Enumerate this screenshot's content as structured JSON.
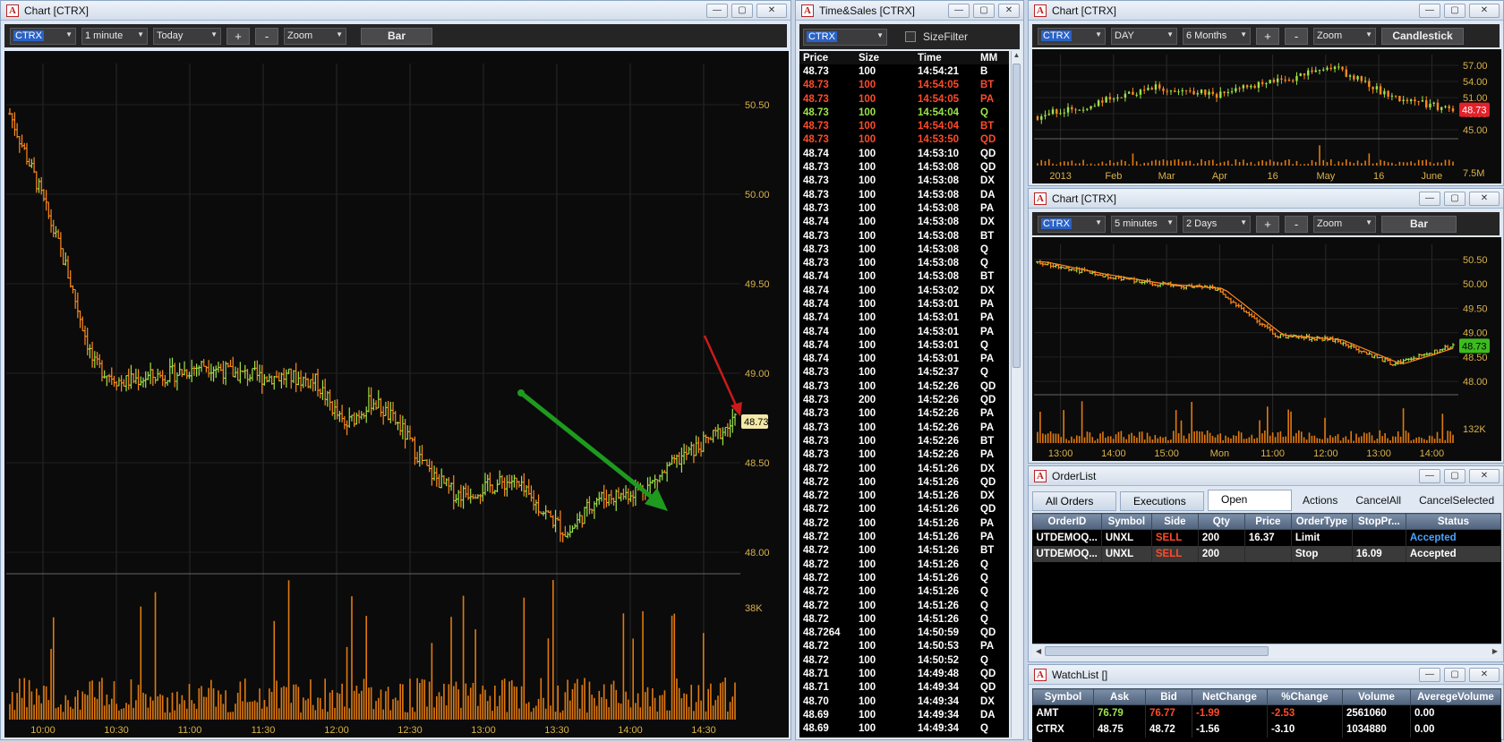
{
  "chart1": {
    "title": "Chart [CTRX]",
    "symbol": "CTRX",
    "interval": "1 minute",
    "range": "Today",
    "zoom": "Zoom",
    "plus": "+",
    "minus": "-",
    "style": "Bar",
    "price_ticks": [
      "50.50",
      "50.00",
      "49.50",
      "49.00",
      "48.50",
      "48.00"
    ],
    "price_tag": "48.73",
    "volume_tick": "38K",
    "time_ticks": [
      "10:00",
      "10:30",
      "11:00",
      "11:30",
      "12:00",
      "12:30",
      "13:00",
      "13:30",
      "14:00",
      "14:30"
    ]
  },
  "chart_data": [
    {
      "type": "line",
      "title": "",
      "xlabel": "",
      "ylabel": "",
      "ylim": [
        47.9,
        50.7
      ],
      "x": [
        "09:45",
        "09:50",
        "09:55",
        "10:00",
        "10:10",
        "10:20",
        "10:30",
        "10:45",
        "11:00",
        "11:10",
        "11:30",
        "11:45",
        "12:00",
        "12:10",
        "12:20",
        "12:30",
        "12:45",
        "13:00",
        "13:15",
        "13:30",
        "13:35",
        "13:45",
        "14:00",
        "14:15",
        "14:30",
        "14:40",
        "14:45"
      ],
      "series": [
        {
          "values": [
            50.45,
            50.05,
            49.6,
            49.05,
            48.95,
            48.98,
            49.0,
            49.05,
            49.0,
            48.98,
            48.98,
            48.95,
            48.7,
            48.85,
            48.7,
            48.45,
            48.32,
            48.36,
            48.4,
            48.25,
            48.1,
            48.3,
            48.32,
            48.38,
            48.52,
            48.62,
            48.73
          ]
        }
      ],
      "volume_ticks": [
        "38K"
      ]
    },
    {
      "type": "line",
      "title": "",
      "ylim": [
        44.0,
        58.0
      ],
      "x": [
        "2013",
        "Feb",
        "Mar",
        "Apr",
        "16",
        "May",
        "16",
        "June"
      ],
      "series": [
        {
          "values": [
            47.5,
            50.0,
            53.0,
            51.5,
            54.0,
            56.5,
            51.0,
            48.73
          ]
        }
      ],
      "price_ticks": [
        "57.00",
        "54.00",
        "51.00",
        "48.00",
        "45.00"
      ],
      "price_tag": "48.73"
    },
    {
      "type": "line",
      "title": "",
      "ylim": [
        47.8,
        50.7
      ],
      "x": [
        "13:00",
        "14:00",
        "15:00",
        "Mon",
        "11:00",
        "12:00",
        "13:00",
        "14:00"
      ],
      "series": [
        {
          "values": [
            50.45,
            50.2,
            50.0,
            49.9,
            48.95,
            48.85,
            48.35,
            48.73
          ]
        }
      ],
      "price_ticks": [
        "50.50",
        "50.00",
        "49.50",
        "49.00",
        "48.50",
        "48.00"
      ],
      "price_tag": "48.73"
    }
  ],
  "timesales": {
    "title": "Time&Sales [CTRX]",
    "symbol": "CTRX",
    "size_filter": "SizeFilter",
    "columns": [
      "Price",
      "Size",
      "Time",
      "MM"
    ],
    "rows": [
      [
        "48.73",
        "100",
        "14:54:21",
        "B",
        ""
      ],
      [
        "48.73",
        "100",
        "14:54:05",
        "BT",
        "dn"
      ],
      [
        "48.73",
        "100",
        "14:54:05",
        "PA",
        "dn"
      ],
      [
        "48.73",
        "100",
        "14:54:04",
        "Q",
        "up"
      ],
      [
        "48.73",
        "100",
        "14:54:04",
        "BT",
        "dn"
      ],
      [
        "48.73",
        "100",
        "14:53:50",
        "QD",
        "dn"
      ],
      [
        "48.74",
        "100",
        "14:53:10",
        "QD",
        ""
      ],
      [
        "48.73",
        "100",
        "14:53:08",
        "QD",
        ""
      ],
      [
        "48.73",
        "100",
        "14:53:08",
        "DX",
        ""
      ],
      [
        "48.73",
        "100",
        "14:53:08",
        "DA",
        ""
      ],
      [
        "48.73",
        "100",
        "14:53:08",
        "PA",
        ""
      ],
      [
        "48.74",
        "100",
        "14:53:08",
        "DX",
        ""
      ],
      [
        "48.73",
        "100",
        "14:53:08",
        "BT",
        ""
      ],
      [
        "48.73",
        "100",
        "14:53:08",
        "Q",
        ""
      ],
      [
        "48.73",
        "100",
        "14:53:08",
        "Q",
        ""
      ],
      [
        "48.74",
        "100",
        "14:53:08",
        "BT",
        ""
      ],
      [
        "48.74",
        "100",
        "14:53:02",
        "DX",
        ""
      ],
      [
        "48.74",
        "100",
        "14:53:01",
        "PA",
        ""
      ],
      [
        "48.74",
        "100",
        "14:53:01",
        "PA",
        ""
      ],
      [
        "48.74",
        "100",
        "14:53:01",
        "PA",
        ""
      ],
      [
        "48.74",
        "100",
        "14:53:01",
        "Q",
        ""
      ],
      [
        "48.74",
        "100",
        "14:53:01",
        "PA",
        ""
      ],
      [
        "48.73",
        "100",
        "14:52:37",
        "Q",
        ""
      ],
      [
        "48.73",
        "100",
        "14:52:26",
        "QD",
        ""
      ],
      [
        "48.73",
        "200",
        "14:52:26",
        "QD",
        ""
      ],
      [
        "48.73",
        "100",
        "14:52:26",
        "PA",
        ""
      ],
      [
        "48.73",
        "100",
        "14:52:26",
        "PA",
        ""
      ],
      [
        "48.73",
        "100",
        "14:52:26",
        "BT",
        ""
      ],
      [
        "48.73",
        "100",
        "14:52:26",
        "PA",
        ""
      ],
      [
        "48.72",
        "100",
        "14:51:26",
        "DX",
        ""
      ],
      [
        "48.72",
        "100",
        "14:51:26",
        "QD",
        ""
      ],
      [
        "48.72",
        "100",
        "14:51:26",
        "DX",
        ""
      ],
      [
        "48.72",
        "100",
        "14:51:26",
        "QD",
        ""
      ],
      [
        "48.72",
        "100",
        "14:51:26",
        "PA",
        ""
      ],
      [
        "48.72",
        "100",
        "14:51:26",
        "PA",
        ""
      ],
      [
        "48.72",
        "100",
        "14:51:26",
        "BT",
        ""
      ],
      [
        "48.72",
        "100",
        "14:51:26",
        "Q",
        ""
      ],
      [
        "48.72",
        "100",
        "14:51:26",
        "Q",
        ""
      ],
      [
        "48.72",
        "100",
        "14:51:26",
        "Q",
        ""
      ],
      [
        "48.72",
        "100",
        "14:51:26",
        "Q",
        ""
      ],
      [
        "48.72",
        "100",
        "14:51:26",
        "Q",
        ""
      ],
      [
        "48.7264",
        "100",
        "14:50:59",
        "QD",
        ""
      ],
      [
        "48.72",
        "100",
        "14:50:53",
        "PA",
        ""
      ],
      [
        "48.72",
        "100",
        "14:50:52",
        "Q",
        ""
      ],
      [
        "48.71",
        "100",
        "14:49:48",
        "QD",
        ""
      ],
      [
        "48.71",
        "100",
        "14:49:34",
        "QD",
        ""
      ],
      [
        "48.70",
        "100",
        "14:49:34",
        "DX",
        ""
      ],
      [
        "48.69",
        "100",
        "14:49:34",
        "DA",
        ""
      ],
      [
        "48.69",
        "100",
        "14:49:34",
        "Q",
        ""
      ]
    ]
  },
  "chart2": {
    "title": "Chart [CTRX]",
    "symbol": "CTRX",
    "interval": "DAY",
    "range": "6 Months",
    "zoom": "Zoom",
    "plus": "+",
    "minus": "-",
    "style": "Candlestick",
    "price_ticks": [
      "57.00",
      "54.00",
      "51.00",
      "48.00",
      "45.00"
    ],
    "price_tag": "48.73",
    "volume_tick": "7.5M",
    "time_ticks": [
      "2013",
      "Feb",
      "Mar",
      "Apr",
      "16",
      "May",
      "16",
      "June"
    ]
  },
  "chart3": {
    "title": "Chart [CTRX]",
    "symbol": "CTRX",
    "interval": "5 minutes",
    "range": "2 Days",
    "zoom": "Zoom",
    "plus": "+",
    "minus": "-",
    "style": "Bar",
    "price_ticks": [
      "50.50",
      "50.00",
      "49.50",
      "49.00",
      "48.50",
      "48.00"
    ],
    "price_tag": "48.73",
    "volume_tick": "132K",
    "time_ticks": [
      "13:00",
      "14:00",
      "15:00",
      "Mon",
      "11:00",
      "12:00",
      "13:00",
      "14:00"
    ]
  },
  "orderlist": {
    "title": "OrderList",
    "tabs": [
      "All Orders",
      "Executions",
      "Open Orders"
    ],
    "actions": [
      "Actions",
      "CancelAll",
      "CancelSelected"
    ],
    "columns": [
      "OrderID",
      "Symbol",
      "Side",
      "Qty",
      "Price",
      "OrderType",
      "StopPr...",
      "Status"
    ],
    "rows": [
      [
        "UTDEMOQ...",
        "UNXL",
        "SELL",
        "200",
        "16.37",
        "Limit",
        "",
        "Accepted"
      ],
      [
        "UTDEMOQ...",
        "UNXL",
        "SELL",
        "200",
        "",
        "Stop",
        "16.09",
        "Accepted"
      ]
    ]
  },
  "watchlist": {
    "title": "WatchList []",
    "columns": [
      "Symbol",
      "Ask",
      "Bid",
      "NetChange",
      "%Change",
      "Volume",
      "AveregeVolume"
    ],
    "rows": [
      [
        "AMT",
        "76.79",
        "76.77",
        "-1.99",
        "-2.53",
        "2561060",
        "0.00"
      ],
      [
        "CTRX",
        "48.75",
        "48.72",
        "-1.56",
        "-3.10",
        "1034880",
        "0.00"
      ]
    ]
  },
  "colors": {
    "up": "#9ee34b",
    "down": "#ff4b2b",
    "accent_price": "#d9b24a"
  }
}
